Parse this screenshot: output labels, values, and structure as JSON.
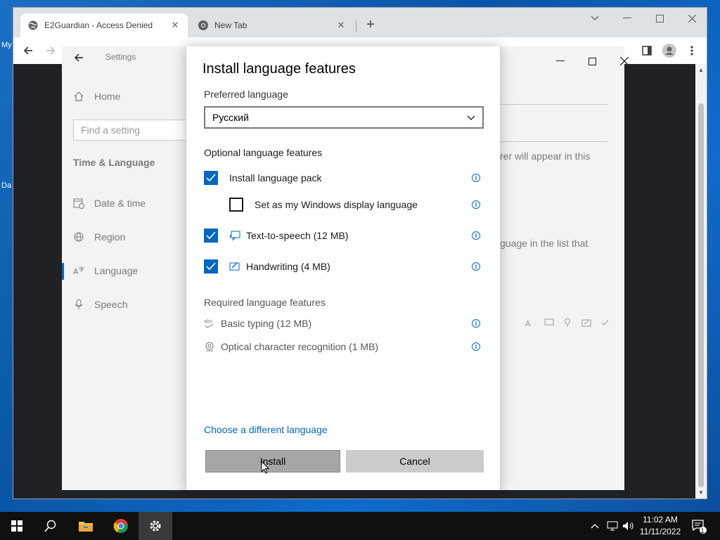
{
  "desktop": {
    "fragments": [
      "My",
      "Da"
    ]
  },
  "chrome": {
    "tabs": [
      {
        "title": "E2Guardian - Access Denied",
        "icon": "globe-icon",
        "active": true
      },
      {
        "title": "New Tab",
        "icon": "chrome-icon",
        "active": false
      }
    ],
    "new_tab_symbol": "+"
  },
  "settings": {
    "header_title": "Settings",
    "home_label": "Home",
    "search_placeholder": "Find a setting",
    "section_title": "Time & Language",
    "nav_items": [
      {
        "label": "Date & time",
        "icon": "calendar-clock-icon"
      },
      {
        "label": "Region",
        "icon": "globe-icon"
      },
      {
        "label": "Language",
        "icon": "language-icon",
        "selected": true
      },
      {
        "label": "Speech",
        "icon": "microphone-icon"
      }
    ],
    "background_text": [
      "rer will appear in this",
      "guage in the list that"
    ],
    "accent_color": "#0067c0"
  },
  "dialog": {
    "title": "Install language features",
    "preferred_label": "Preferred language",
    "selected_language": "Русский",
    "optional_heading": "Optional language features",
    "optional_features": [
      {
        "label": "Install language pack",
        "checked": true,
        "icon": null
      },
      {
        "label": "Set as my Windows display language",
        "checked": false,
        "icon": null
      },
      {
        "label": "Text-to-speech (12 MB)",
        "checked": true,
        "icon": "speech-bubble-icon"
      },
      {
        "label": "Handwriting (4 MB)",
        "checked": true,
        "icon": "handwriting-icon"
      }
    ],
    "required_heading": "Required language features",
    "required_features": [
      {
        "label": "Basic typing (12 MB)",
        "icon": "abc-check-icon"
      },
      {
        "label": "Optical character recognition (1 MB)",
        "icon": "ocr-icon"
      }
    ],
    "choose_link": "Choose a different language",
    "install_button": "Install",
    "cancel_button": "Cancel"
  },
  "taskbar": {
    "time": "11:02 AM",
    "date": "11/11/2022",
    "notification_count": "1"
  }
}
